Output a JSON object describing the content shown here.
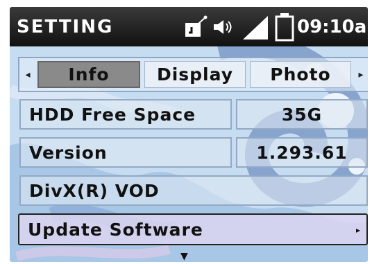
{
  "status_bar": {
    "title": "SETTING",
    "clock": "09:10a",
    "icons": [
      "usb-device-icon",
      "speaker-icon",
      "signal-icon",
      "battery-icon"
    ]
  },
  "tabs": {
    "items": [
      {
        "label": "Info",
        "active": true
      },
      {
        "label": "Display",
        "active": false
      },
      {
        "label": "Photo",
        "active": false
      }
    ],
    "left_arrow": "◂",
    "right_arrow": "▸"
  },
  "rows": [
    {
      "label": "HDD Free Space",
      "value": "35G"
    },
    {
      "label": "Version",
      "value": "1.293.61"
    },
    {
      "label": "DivX(R) VOD"
    },
    {
      "label": "Update Software",
      "selected": true,
      "arrow": "▸"
    }
  ],
  "more_indicator": "▼",
  "colors": {
    "status_bar_bg": "#1a1a1a",
    "active_tab_bg": "#8a8a8a",
    "row_border": "#93a9c4",
    "selected_row_bg": "#dbd5f0"
  }
}
